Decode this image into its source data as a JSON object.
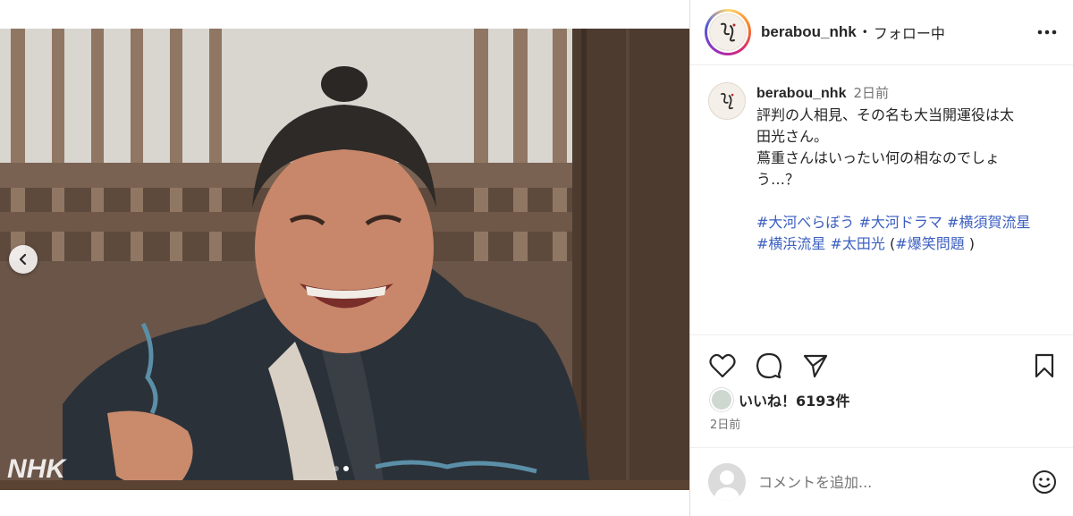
{
  "media": {
    "watermark": "NHK",
    "slide_count": 2,
    "active_slide": 2
  },
  "post": {
    "username": "berabou_nhk",
    "separator": "•",
    "follow_status": "フォロー中",
    "caption": {
      "username": "berabou_nhk",
      "time": "2日前",
      "lines": [
        "評判の人相見、その名も大当開運役は太",
        "田光さん。",
        "蔦重さんはいったい何の相なのでしょ",
        "う…？"
      ],
      "hashtags_line1": [
        "#大河べらぼう",
        "#大河ドラマ",
        "#横須賀流星"
      ],
      "hashtags_line2_a": [
        "#横浜流星",
        "#太田光"
      ],
      "paren_open": "(",
      "hashtag_paren": "#爆笑問題",
      "paren_close": ")"
    },
    "likes": "いいね！6193件",
    "date": "2日前"
  },
  "comment": {
    "placeholder": "コメントを追加..."
  },
  "icons": {
    "more": "more-horizontal-icon",
    "like": "heart-icon",
    "comment": "comment-icon",
    "share": "paper-plane-icon",
    "save": "bookmark-icon",
    "emoji": "emoji-smile-icon",
    "prev": "chevron-left-icon"
  }
}
